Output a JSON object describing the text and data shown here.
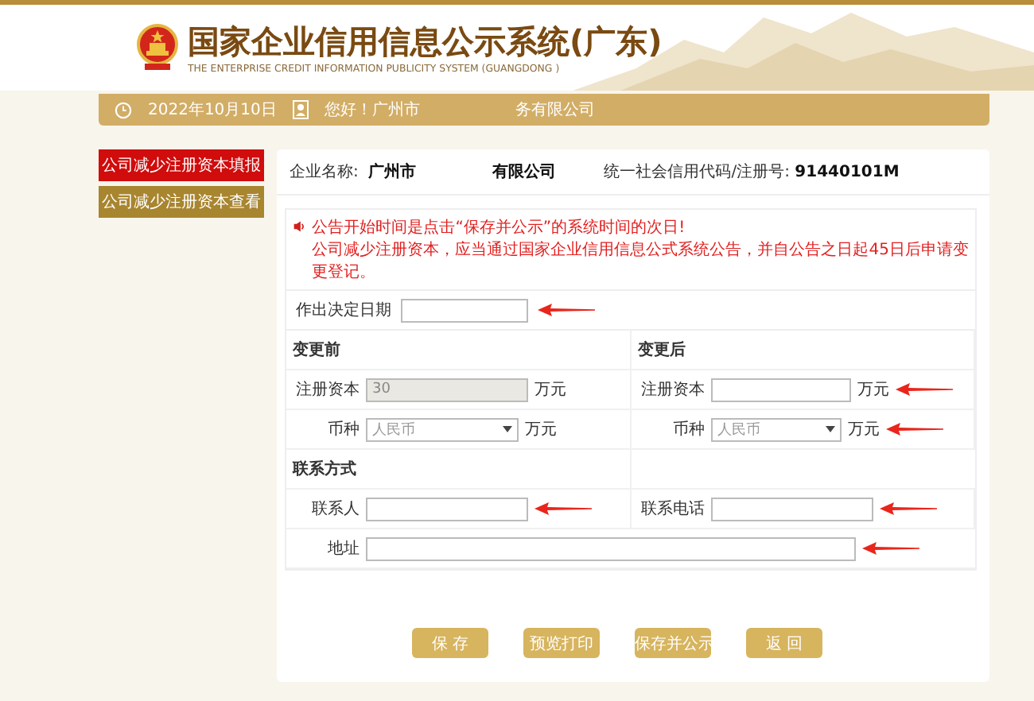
{
  "header": {
    "title": "国家企业信用信息公示系统(广东)",
    "subtitle": "THE ENTERPRISE CREDIT INFORMATION PUBLICITY SYSTEM (GUANGDONG )"
  },
  "info_bar": {
    "date": "2022年10月10日",
    "greeting": "您好！广州市",
    "greeting_end": "务有限公司"
  },
  "sidebar": [
    {
      "label": "公司减少注册资本填报",
      "selected": true
    },
    {
      "label": "公司减少注册资本查看",
      "selected": false
    }
  ],
  "company": {
    "name_label": "企业名称:",
    "name_start": "广州市",
    "name_end": "有限公司",
    "code_label": "统一社会信用代码/注册号:",
    "code": "91440101M"
  },
  "notice": [
    "公告开始时间是点击“保存并公示”的系统时间的次日!",
    "公司减少注册资本，应当通过国家企业信用信息公式系统公告，并自公告之日起45日后申请变更登记。"
  ],
  "decision_date": {
    "label": "作出决定日期",
    "marked": true
  },
  "before": {
    "title": "变更前",
    "capital": {
      "label": "注册资本",
      "value": "30",
      "unit": "万元",
      "disabled": true,
      "marked": false
    },
    "currency": {
      "label": "币种",
      "value": "人民币",
      "unit": "万元",
      "marked": false
    }
  },
  "after": {
    "title": "变更后",
    "capital": {
      "label": "注册资本",
      "unit": "万元",
      "disabled": false,
      "marked": true
    },
    "currency": {
      "label": "币种",
      "value": "人民币",
      "unit": "万元",
      "marked": true
    }
  },
  "contact": {
    "title": "联系方式",
    "person": {
      "label": "联系人",
      "marked": true
    },
    "phone": {
      "label": "联系电话",
      "marked": true
    },
    "address": {
      "label": "地址",
      "marked": true
    }
  },
  "buttons": [
    "保 存",
    "预览打印",
    "保存并公示",
    "返 回"
  ]
}
